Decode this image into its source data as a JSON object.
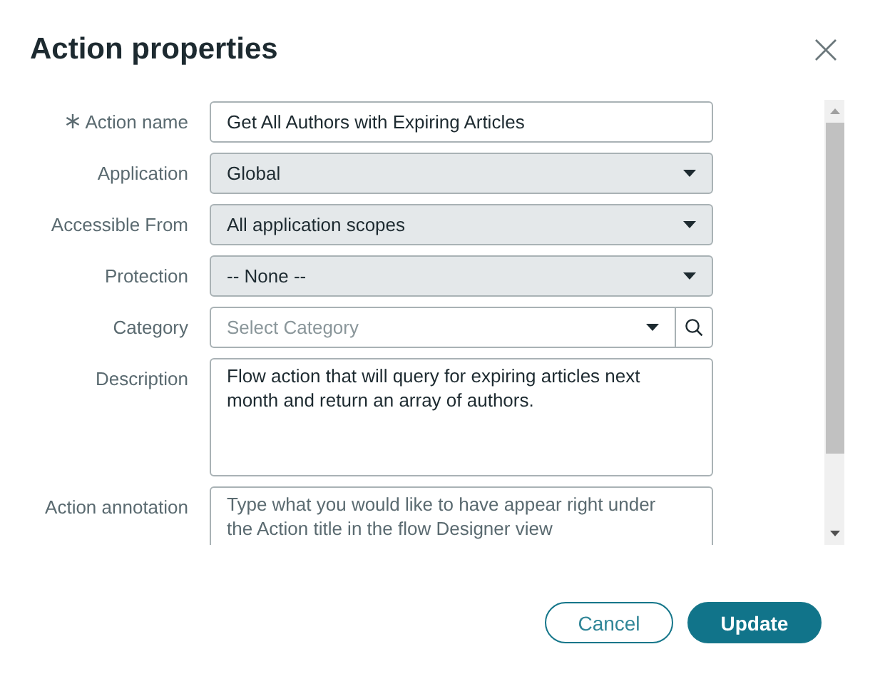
{
  "dialog": {
    "title": "Action properties"
  },
  "fields": [
    {
      "kind": "text",
      "label": "Action name",
      "required": true,
      "value": "Get All Authors with Expiring Articles"
    },
    {
      "kind": "select",
      "label": "Application",
      "required": false,
      "value": "Global"
    },
    {
      "kind": "select",
      "label": "Accessible From",
      "required": false,
      "value": "All application scopes"
    },
    {
      "kind": "select",
      "label": "Protection",
      "required": false,
      "value": "-- None --"
    },
    {
      "kind": "lookup",
      "label": "Category",
      "required": false,
      "placeholder": "Select Category"
    },
    {
      "kind": "textarea",
      "label": "Description",
      "required": false,
      "value": "Flow action that will query for expiring articles next month and return an array of authors."
    },
    {
      "kind": "textarea",
      "label": "Action annotation",
      "required": false,
      "placeholder": "Type what you would like to have appear right under the Action title in the flow Designer view"
    }
  ],
  "buttons": [
    {
      "kind": "secondary",
      "label": "Cancel"
    },
    {
      "kind": "primary",
      "label": "Update"
    }
  ]
}
